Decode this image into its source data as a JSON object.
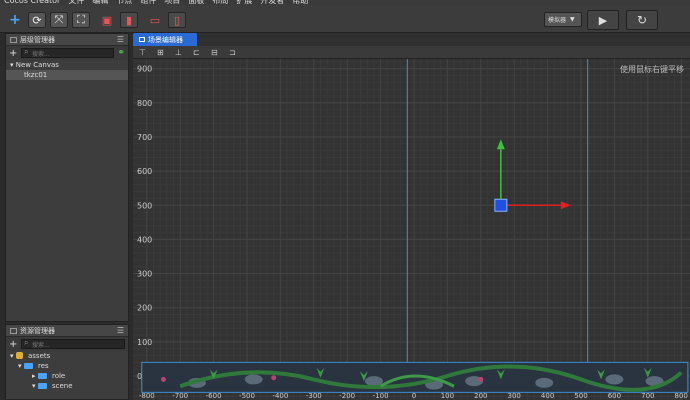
{
  "menubar": [
    "Cocos Creator",
    "文件",
    "编辑",
    "节点",
    "组件",
    "项目",
    "面板",
    "布局",
    "扩展",
    "开发者",
    "帮助"
  ],
  "toolbar": {
    "device_select": "模拟器",
    "play_icon": "play-icon",
    "refresh_icon": "refresh-icon"
  },
  "hierarchy": {
    "title": "层级管理器",
    "search_placeholder": "搜索...",
    "items": [
      {
        "label": "New Canvas"
      },
      {
        "label": "tkzc01"
      }
    ]
  },
  "assets": {
    "title": "资源管理器",
    "search_placeholder": "搜索...",
    "items": [
      {
        "label": "assets"
      },
      {
        "label": "res"
      },
      {
        "label": "role"
      },
      {
        "label": "scene"
      }
    ]
  },
  "scene_editor": {
    "tab_label": "场景编辑器",
    "hint": "使用鼠标右键平移",
    "y_ticks": [
      "900",
      "800",
      "700",
      "600",
      "500",
      "400",
      "300",
      "200",
      "100",
      "0"
    ],
    "x_ticks": [
      "-800",
      "-700",
      "-600",
      "-500",
      "-400",
      "-300",
      "-200",
      "-100",
      "0",
      "100",
      "200",
      "300",
      "400",
      "500",
      "600",
      "700",
      "800"
    ]
  },
  "colors": {
    "accent": "#2a6ad6",
    "frame": "#3a8fd8",
    "gizmo_x": "#e02020",
    "gizmo_y": "#40c040",
    "gizmo_center": "#2050e0"
  }
}
